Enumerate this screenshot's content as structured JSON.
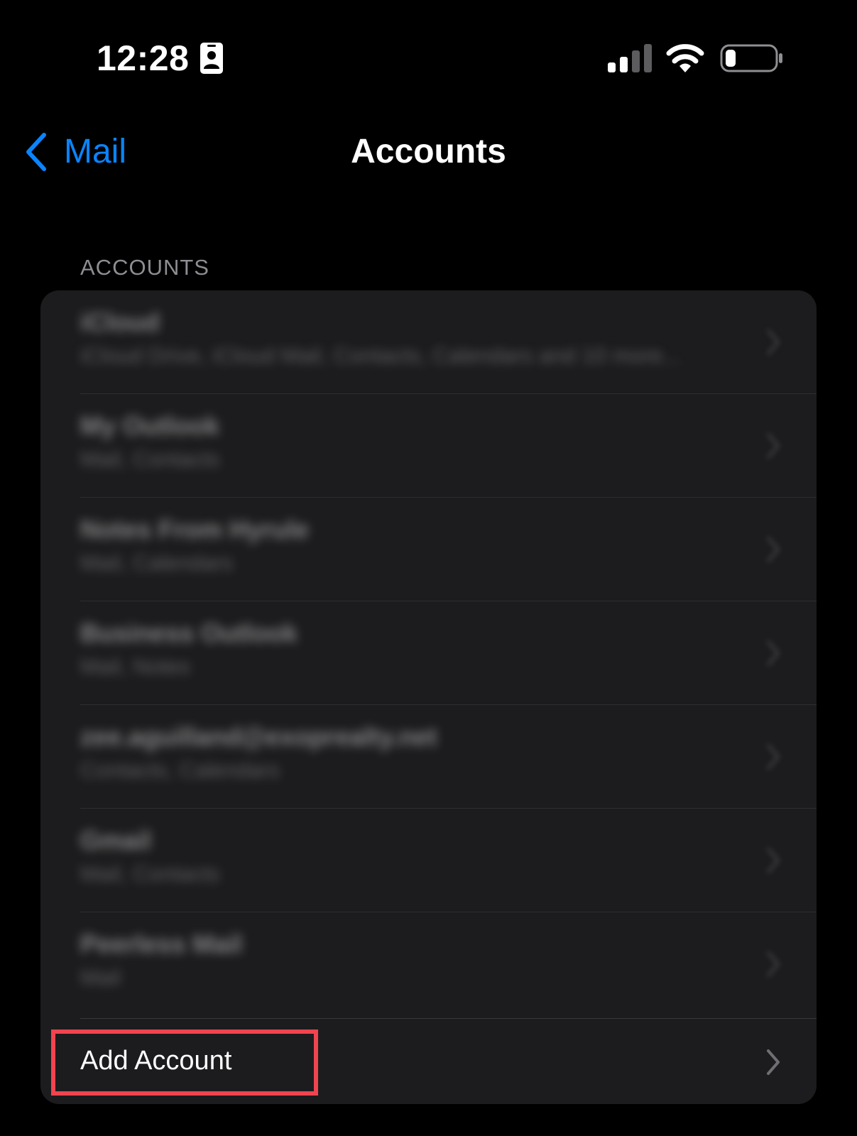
{
  "status_bar": {
    "time": "12:28",
    "signal_bars_active": 2,
    "signal_bars_total": 4,
    "battery_level_fraction": 0.15
  },
  "nav": {
    "back_label": "Mail",
    "title": "Accounts"
  },
  "section": {
    "header": "ACCOUNTS"
  },
  "accounts": [
    {
      "name": "iCloud",
      "detail": "iCloud Drive, iCloud Mail, Contacts, Calendars and 10 more..."
    },
    {
      "name": "My Outlook",
      "detail": "Mail, Contacts"
    },
    {
      "name": "Notes From Hyrule",
      "detail": "Mail, Calendars"
    },
    {
      "name": "Business Outlook",
      "detail": "Mail, Notes"
    },
    {
      "name": "zee.aguilland@exoprealty.net",
      "detail": "Contacts, Calendars"
    },
    {
      "name": "Gmail",
      "detail": "Mail, Contacts"
    },
    {
      "name": "Peerless Mail",
      "detail": "Mail"
    }
  ],
  "add_account": {
    "label": "Add Account"
  },
  "colors": {
    "accent": "#0a84ff",
    "card_background": "#1c1c1e",
    "section_header": "#8d8d93",
    "highlight": "#f0444f"
  },
  "icons": {
    "back": "chevron-left-icon",
    "row": "chevron-right-icon",
    "status": [
      "contact-card-icon",
      "signal-icon",
      "wifi-icon",
      "battery-icon"
    ]
  }
}
